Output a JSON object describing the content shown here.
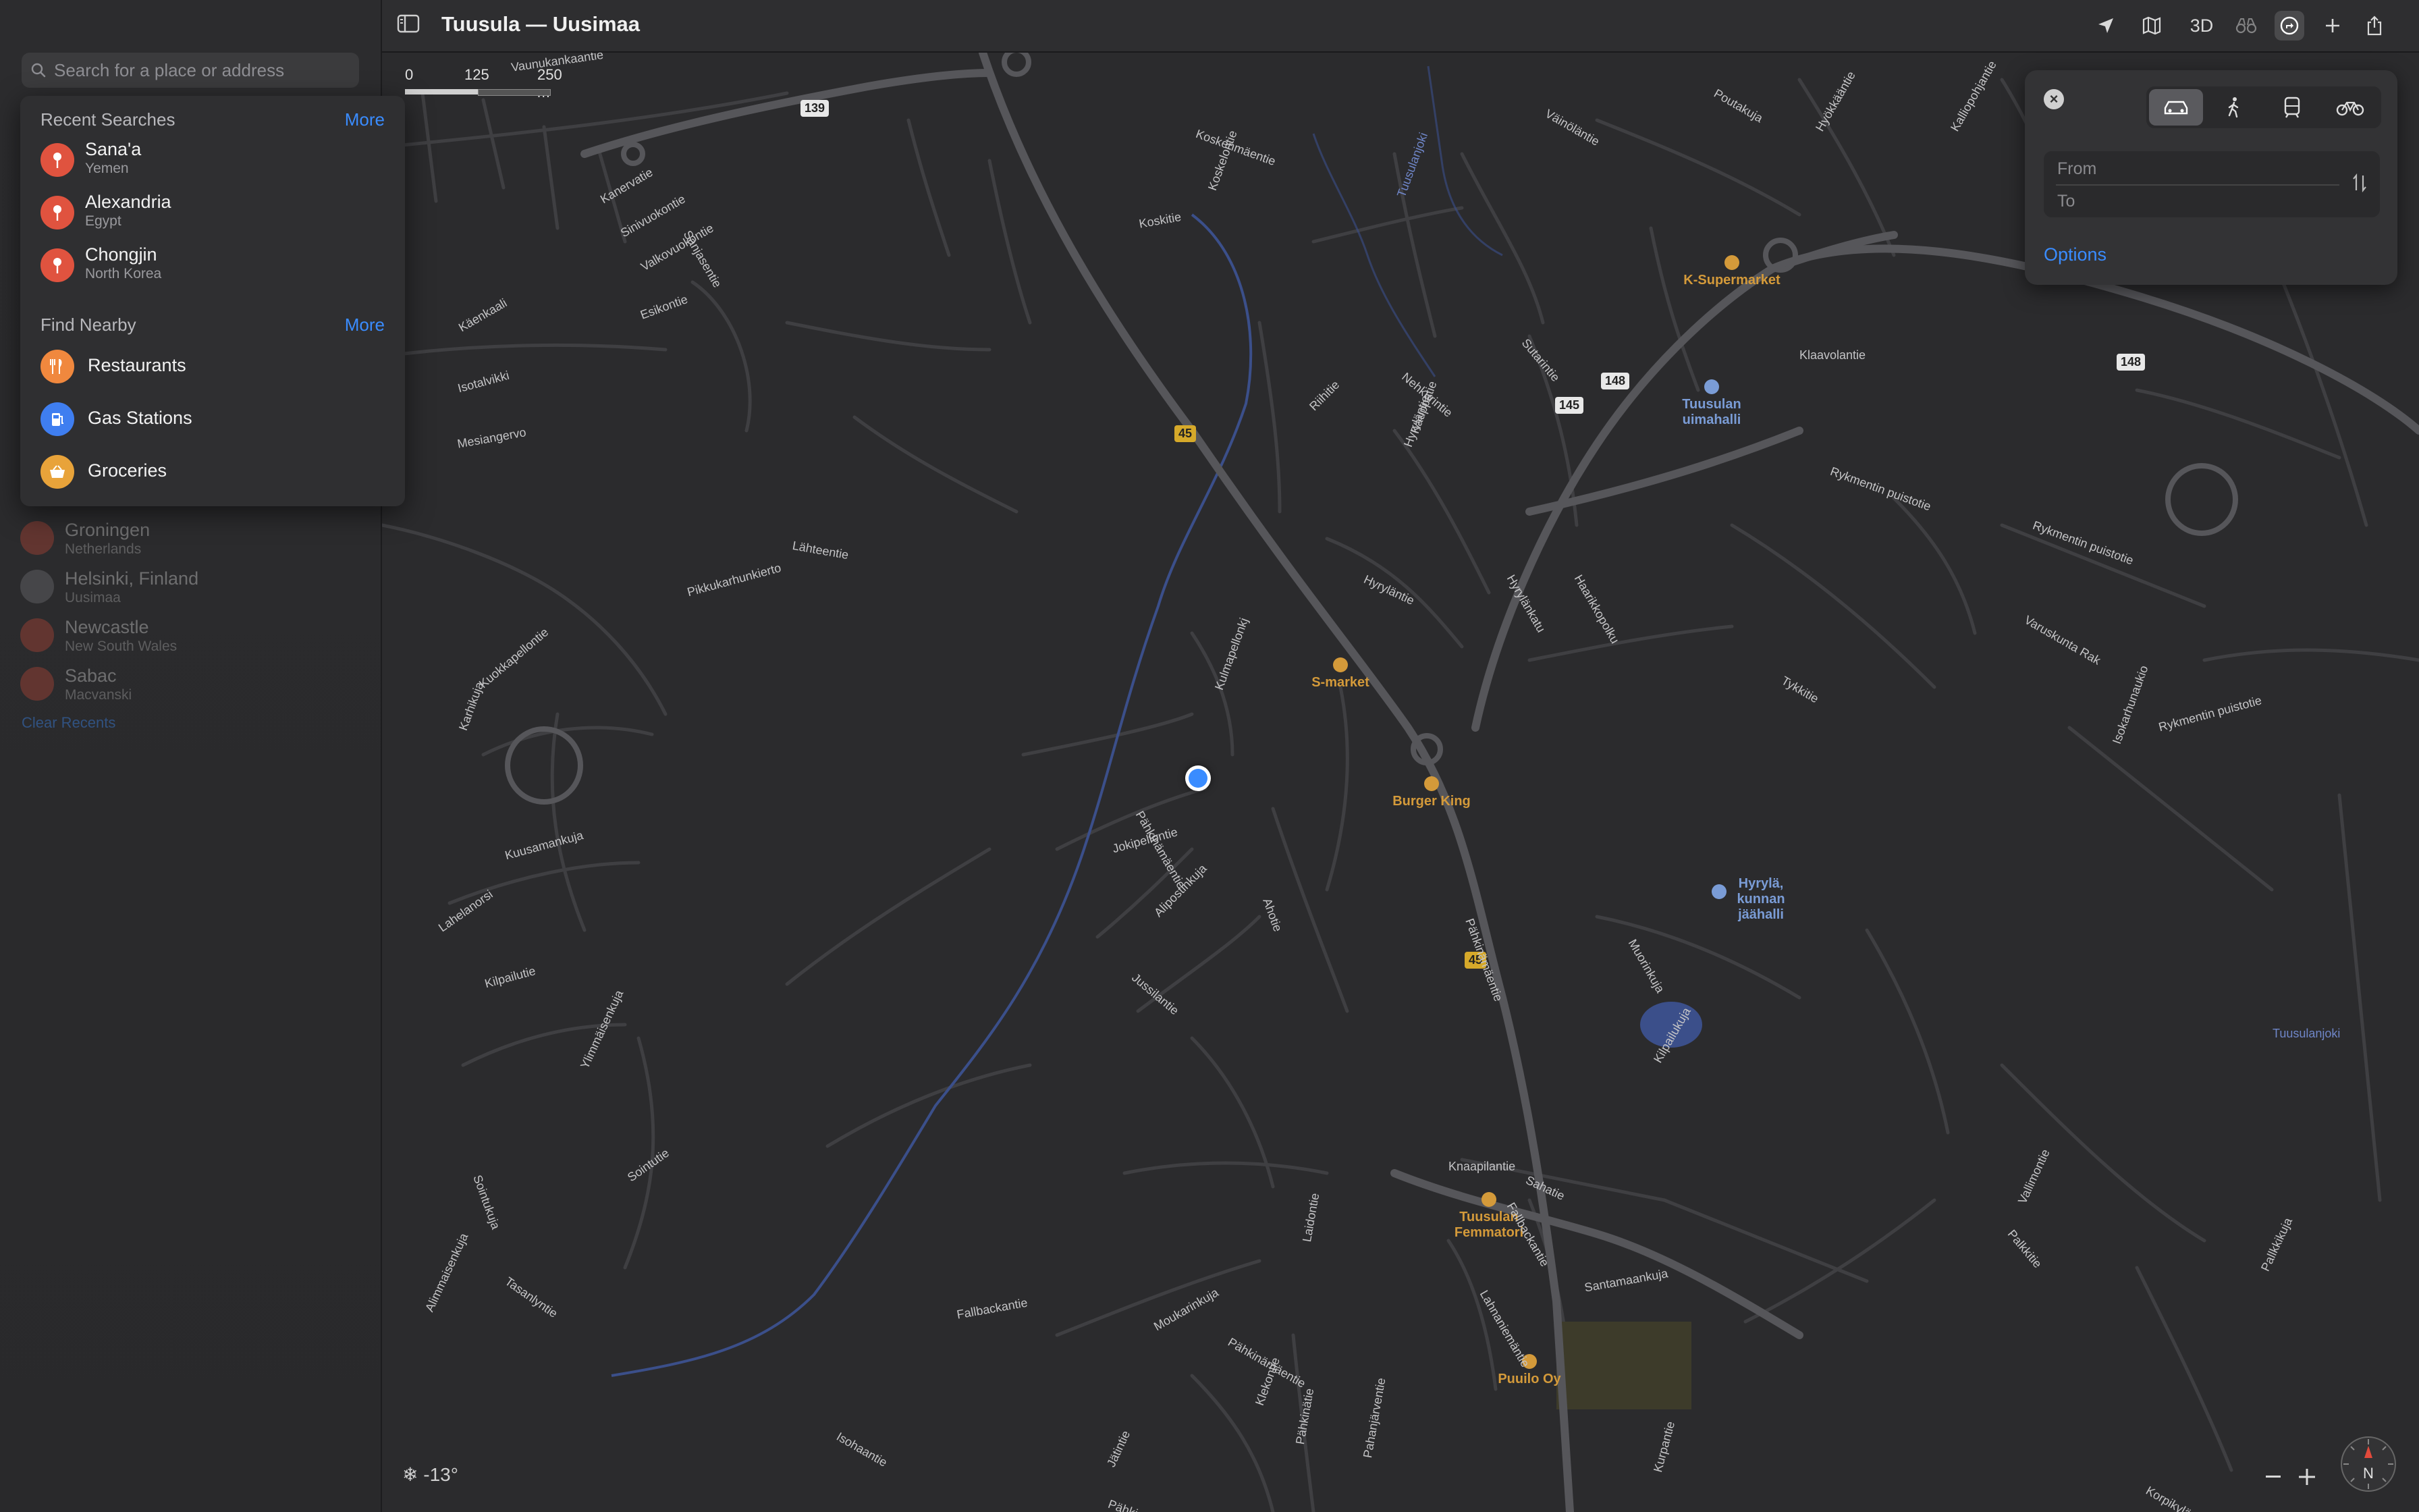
{
  "window": {
    "title": "Tuusula — Uusimaa"
  },
  "search": {
    "placeholder": "Search for a place or address"
  },
  "recent_searches": {
    "header": "Recent Searches",
    "more_label": "More",
    "items": [
      {
        "title": "Sana'a",
        "subtitle": "Yemen"
      },
      {
        "title": "Alexandria",
        "subtitle": "Egypt"
      },
      {
        "title": "Chongjin",
        "subtitle": "North Korea"
      }
    ]
  },
  "find_nearby": {
    "header": "Find Nearby",
    "more_label": "More",
    "items": [
      {
        "label": "Restaurants",
        "icon": "fork-knife-icon",
        "color": "#f0883e"
      },
      {
        "label": "Gas Stations",
        "icon": "fuel-pump-icon",
        "color": "#3f7ef0"
      },
      {
        "label": "Groceries",
        "icon": "basket-icon",
        "color": "#e8a33a"
      }
    ]
  },
  "background_recents": [
    {
      "title": "Groningen",
      "subtitle": "Netherlands",
      "icon": "pin-icon"
    },
    {
      "title": "Helsinki, Finland",
      "subtitle": "Uusimaa",
      "icon": "search-icon"
    },
    {
      "title": "Newcastle",
      "subtitle": "New South Wales",
      "icon": "pin-icon"
    },
    {
      "title": "Sabac",
      "subtitle": "Macvanski",
      "icon": "pin-icon"
    }
  ],
  "clear_recents_label": "Clear Recents",
  "toolbar": {
    "buttons": [
      "location-arrow-icon",
      "map-mode-icon",
      "3d-toggle",
      "binoculars-icon",
      "directions-icon",
      "add-icon",
      "share-icon"
    ],
    "label_3d": "3D"
  },
  "scale": {
    "labels": [
      "0",
      "125",
      "250 m"
    ]
  },
  "directions": {
    "from_placeholder": "From",
    "to_placeholder": "To",
    "options_label": "Options",
    "modes": [
      "car-icon",
      "walk-icon",
      "transit-icon",
      "bike-icon"
    ],
    "active_mode": "car-icon"
  },
  "weather": {
    "icon": "snowflake-icon",
    "text": "-13°"
  },
  "compass": {
    "label": "N"
  },
  "map_labels": {
    "roads": [
      "Vaunukankaantie",
      "Koskenmäentie",
      "Koskitie",
      "Koskelontie",
      "Tuusulanjoki",
      "Väinöläntie",
      "Poutakuja",
      "Hyökkääntie",
      "Kalliopohjantie",
      "Kanervatie",
      "Sinivuokontie",
      "Valkovuokontie",
      "Esikontie",
      "Sanjasentie",
      "Lähteentie",
      "Käenkaali",
      "Isotalvikki",
      "Mesiangervo",
      "Klaavolantie",
      "Rykmentin puistotie",
      "Rykmentin puistotie",
      "Sutarintie",
      "Nehkurintie",
      "Riihitie",
      "Hyryläntie",
      "Kauppatie",
      "Hyryläntie",
      "Hyrylänkatu",
      "Haarikkopolku",
      "Tykkitie",
      "Varuskunta Rak",
      "Isokarhunaukio",
      "Rykmentin puistotie",
      "Pikkukarhunkierto",
      "Kuokkapellontie",
      "Karhikuja",
      "Kuusamankuja",
      "Lahelanorsi",
      "Kulmapellonkj",
      "Pähkinämäentie",
      "Jokipellontie",
      "Alipostinkuja",
      "Jussilantie",
      "Ahotie",
      "Pähkinämäentie",
      "Muorinkuja",
      "Kilpailukuja",
      "Kilpailutie",
      "Ylimmäisenkuja",
      "Sointutie",
      "Sointukuja",
      "Tasanlyntie",
      "Alimmaisenkuja",
      "Knaapilantie",
      "Sahatie",
      "Fallbackantie",
      "Laidontie",
      "Lahnaniemäntie",
      "Santamaankuja",
      "Moukarinkuja",
      "Pähkinämäentie",
      "Klekontie",
      "Isohaantie",
      "Pähkinätie",
      "Pahanjärventie",
      "Jätintie",
      "Pähkinämäentie",
      "Kurpantie",
      "Vallimontie",
      "Palkkitie",
      "Pallkkikuja",
      "Korpikyläntie",
      "Fallbackantie",
      "Tuusulanjoki"
    ],
    "route_shields": [
      "139",
      "45",
      "45",
      "148",
      "145",
      "148"
    ],
    "pois": [
      {
        "name": "K-Supermarket",
        "color": "#d49a3a"
      },
      {
        "name": "Tuusulan uimahalli",
        "color": "#7a9cd6"
      },
      {
        "name": "S-market",
        "color": "#d49a3a"
      },
      {
        "name": "Burger King",
        "color": "#d49a3a"
      },
      {
        "name": "Hyrylä, kunnan jäähalli",
        "color": "#7a9cd6"
      },
      {
        "name": "Tuusulan Femmatori",
        "color": "#d49a3a"
      },
      {
        "name": "Puuilo Oy",
        "color": "#d49a3a"
      }
    ]
  },
  "colors": {
    "accent": "#3a8cff",
    "map_background": "#2b2b2d",
    "road": "#4a4a4d",
    "highway": "#5a5a5e",
    "river": "#3b4f8a",
    "user_location": "#3a8cff"
  }
}
